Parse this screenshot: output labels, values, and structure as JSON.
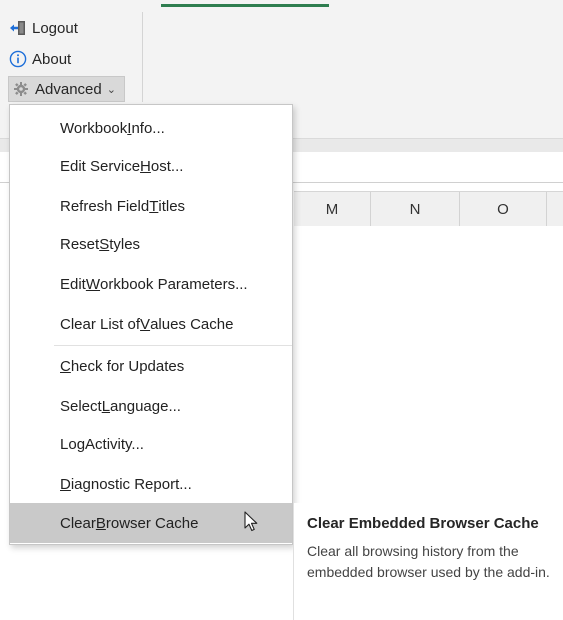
{
  "ribbon": {
    "logout_label": "Logout",
    "about_label": "About",
    "advanced_label": "Advanced",
    "advanced_caret": "⌄"
  },
  "columns": [
    "M",
    "N",
    "O"
  ],
  "menu": {
    "items": [
      {
        "pre": "Workbook ",
        "key": "I",
        "post": "nfo..."
      },
      {
        "pre": "Edit Service ",
        "key": "H",
        "post": "ost..."
      },
      {
        "pre": "Refresh Field ",
        "key": "T",
        "post": "itles"
      },
      {
        "pre": "Reset ",
        "key": "S",
        "post": "tyles"
      },
      {
        "pre": "Edit ",
        "key": "W",
        "post": "orkbook Parameters..."
      },
      {
        "pre": "Clear List of ",
        "key": "V",
        "post": "alues Cache"
      },
      {
        "pre": "",
        "key": "C",
        "post": "heck for Updates"
      },
      {
        "pre": "Select ",
        "key": "L",
        "post": "anguage..."
      },
      {
        "pre": "Lo",
        "key": "g",
        "post": " Activity..."
      },
      {
        "pre": "",
        "key": "D",
        "post": "iagnostic Report..."
      },
      {
        "pre": "Clear ",
        "key": "B",
        "post": "rowser Cache"
      }
    ]
  },
  "tooltip": {
    "title": "Clear Embedded Browser Cache",
    "body": "Clear all browsing history from the embedded browser used by the add-in."
  },
  "colors": {
    "accent_green": "#2e7d4f",
    "hover_gray": "#c9c9c9",
    "about_blue": "#1e6fd9"
  }
}
